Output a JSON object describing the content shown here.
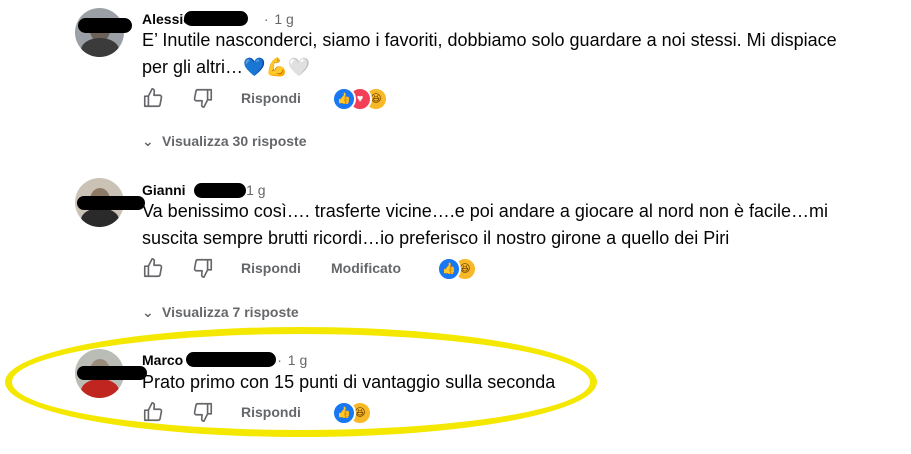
{
  "comments": [
    {
      "author": "Alessio",
      "time": "1 g",
      "text_line1": "E’ Inutile nasconderci, siamo i favoriti, dobbiamo solo guardare a noi stessi. Mi dispiace",
      "text_line2": "per gli altri…💙💪🤍",
      "reply_label": "Rispondi",
      "reactions": [
        "like",
        "love",
        "haha"
      ],
      "view_replies": "Visualizza 30 risposte"
    },
    {
      "author": "Gianni",
      "time": "1 g",
      "text_line1": "Va benissimo così…. trasferte vicine….e poi andare a giocare al nord non è facile…mi",
      "text_line2": "suscita sempre brutti ricordi…io preferisco il nostro girone a quello dei Piri",
      "reply_label": "Rispondi",
      "edited_label": "Modificato",
      "reactions": [
        "like",
        "haha"
      ],
      "view_replies": "Visualizza 7 risposte"
    },
    {
      "author": "Marco",
      "time": "1 g",
      "text_line1": "Prato primo con 15 punti di vantaggio sulla seconda",
      "reply_label": "Rispondi",
      "reactions": [
        "like",
        "haha"
      ]
    }
  ],
  "icons": {
    "like": "thumbs-up-icon",
    "dislike": "thumbs-down-icon",
    "chevron": "chevron-down-icon"
  },
  "colors": {
    "highlight": "#f5e800",
    "like": "#1877f2",
    "love": "#f33e58",
    "haha": "#f7b928",
    "muted": "#65676b"
  }
}
